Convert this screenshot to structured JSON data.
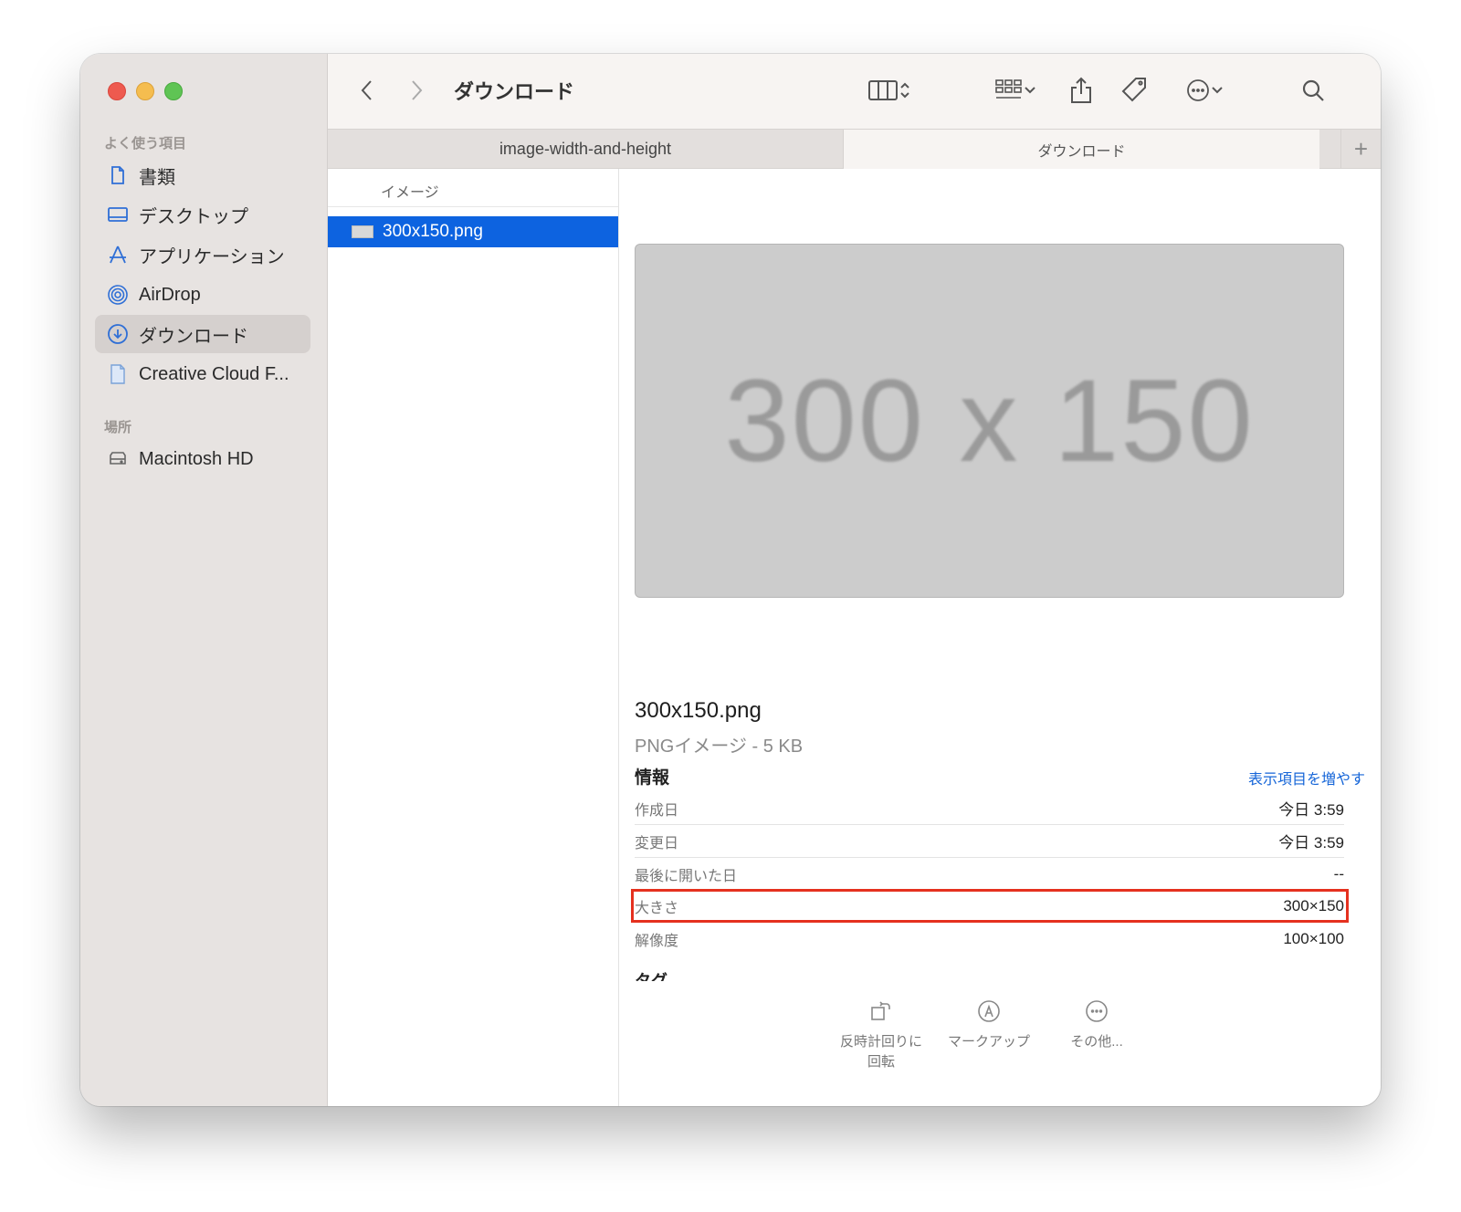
{
  "window": {
    "title": "ダウンロード"
  },
  "sidebar": {
    "favorites_title": "よく使う項目",
    "items": [
      {
        "label": "書類",
        "icon": "document-icon"
      },
      {
        "label": "デスクトップ",
        "icon": "desktop-icon"
      },
      {
        "label": "アプリケーション",
        "icon": "applications-icon"
      },
      {
        "label": "AirDrop",
        "icon": "airdrop-icon"
      },
      {
        "label": "ダウンロード",
        "icon": "download-icon",
        "selected": true
      },
      {
        "label": "Creative Cloud F...",
        "icon": "file-icon"
      }
    ],
    "locations_title": "場所",
    "locations": [
      {
        "label": "Macintosh HD",
        "icon": "disk-icon"
      }
    ]
  },
  "tabs": [
    {
      "label": "image-width-and-height",
      "active": false
    },
    {
      "label": "ダウンロード",
      "active": true
    }
  ],
  "tab_add": "+",
  "column": {
    "header": "イメージ",
    "selected_file": "300x150.png"
  },
  "preview": {
    "thumbnail_text": "300 x 150",
    "file_name": "300x150.png",
    "file_type": "PNGイメージ - 5 KB",
    "info_title": "情報",
    "show_more": "表示項目を増やす",
    "rows": [
      {
        "key": "作成日",
        "value": "今日 3:59"
      },
      {
        "key": "変更日",
        "value": "今日 3:59"
      },
      {
        "key": "最後に開いた日",
        "value": "--"
      },
      {
        "key": "大きさ",
        "value": "300×150"
      },
      {
        "key": "解像度",
        "value": "100×100"
      }
    ],
    "tags_title": "タグ",
    "actions": [
      {
        "label": "反時計回りに\n回転",
        "icon": "rotate-left-icon"
      },
      {
        "label": "マークアップ",
        "icon": "markup-icon"
      },
      {
        "label": "その他...",
        "icon": "more-icon"
      }
    ]
  },
  "colors": {
    "selection": "#0d63e0",
    "highlight_box": "#e5311f",
    "link": "#1565d8"
  }
}
